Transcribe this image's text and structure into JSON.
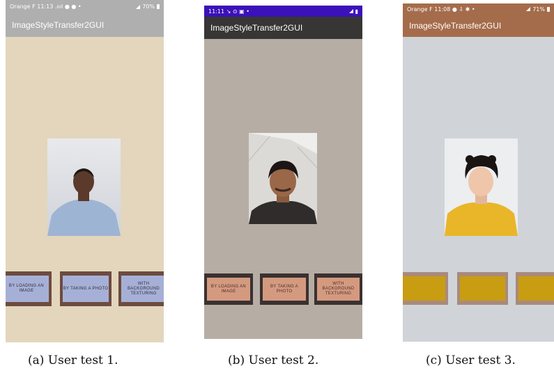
{
  "screens": [
    {
      "status": {
        "left": "Orange F  11:13 .ıııl ● ● •",
        "right": "70%"
      },
      "app_title": "ImageStyleTransfer2GUI",
      "buttons": [
        "BY LOADING AN IMAGE",
        "BY TAKING A PHOTO",
        "WITH BACKGROUND TEXTURING"
      ],
      "colors": {
        "status_bar": "#b0afaf",
        "app_bar": "#b0afaf",
        "background": "#e3d6bd",
        "button_frame": "#6d4b3f",
        "button_face": "#a6b0d7"
      }
    },
    {
      "status": {
        "left": "11:11  ↘ ⊙ ▣  •",
        "right": "▮"
      },
      "app_title": "ImageStyleTransfer2GUI",
      "buttons": [
        "BY LOADING AN IMAGE",
        "BY TAKING A PHOTO",
        "WITH BACKGROUND TEXTURING"
      ],
      "colors": {
        "status_bar": "#3b11b9",
        "app_bar": "#383535",
        "background": "#b6ada4",
        "button_frame": "#3a3130",
        "button_face": "#d49a80"
      }
    },
    {
      "status": {
        "left": "Orange F  11:08 ● ⇩ ✱  •",
        "right": "71%"
      },
      "app_title": "ImageStyleTransfer2GUI",
      "buttons": [
        "",
        "",
        ""
      ],
      "colors": {
        "status_bar": "#a56c4b",
        "app_bar": "#a56c4b",
        "background": "#d0d4d8",
        "button_frame": "#a98a7c",
        "button_face": "#c89d12"
      }
    }
  ],
  "captions": [
    "(a) User test 1.",
    "(b) User test 2.",
    "(c) User test 3."
  ]
}
